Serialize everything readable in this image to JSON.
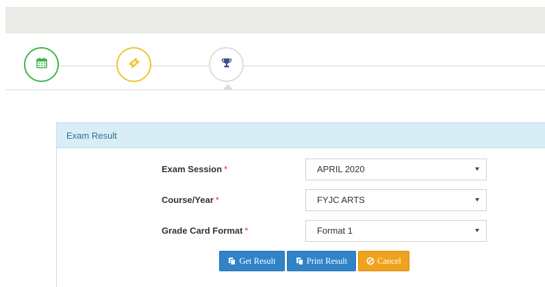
{
  "stepper": {
    "steps": [
      {
        "icon": "calendar-icon",
        "color": "#3bb54a"
      },
      {
        "icon": "ticket-icon",
        "color": "#f2c12e"
      },
      {
        "icon": "trophy-icon",
        "color": "#3f4a8f"
      }
    ]
  },
  "panel": {
    "title": "Exam Result",
    "fields": [
      {
        "label": "Exam Session",
        "required_mark": "*",
        "value": "APRIL 2020"
      },
      {
        "label": "Course/Year",
        "required_mark": "*",
        "value": "FYJC ARTS"
      },
      {
        "label": "Grade Card Format",
        "required_mark": "*",
        "value": "Format 1"
      }
    ],
    "buttons": {
      "get_result": "Get Result",
      "print_result": "Print Result",
      "cancel": "Cancel"
    }
  },
  "colors": {
    "primary_button": "#3183c8",
    "cancel_button": "#f0a11e",
    "panel_heading_bg": "#d9edf7",
    "required": "#e0282e"
  }
}
